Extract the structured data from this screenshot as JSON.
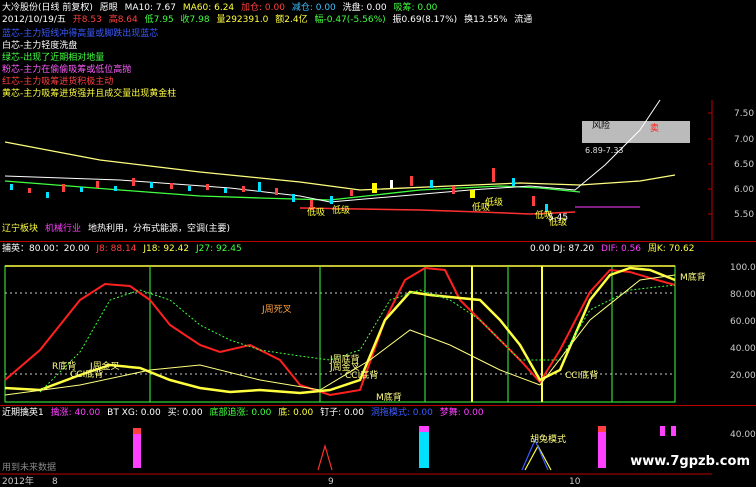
{
  "header": {
    "stock": "大冷股份(日线 前复权)",
    "indicator": "愿眼",
    "ma10": "MA10: 7.67",
    "ma60": "MA60: 6.24",
    "up": "加仓: 0.00",
    "down": "减仓: 0.00",
    "wash": "洗盘: 0.00",
    "absorb": "吸筹: 0.00",
    "date": "2012/10/19/五",
    "open": "开8.53",
    "high": "高8.64",
    "low": "低7.95",
    "close": "收7.98",
    "volume": "量292391.0",
    "amount": "额2.4亿",
    "change": "幅-0.47(-5.56%)",
    "amplitude": "振0.69(8.17%)",
    "turnover": "换13.55%",
    "circ": "流通"
  },
  "legend": [
    {
      "text": "蓝芯-主力短线冲得高量或脚跌出现蓝芯",
      "color": "#3b5bff"
    },
    {
      "text": "白芯-主力轻度洗盘",
      "color": "#ffffff"
    },
    {
      "text": "绿芯-出现了近期相对地量",
      "color": "#40ff40"
    },
    {
      "text": "粉芯-主力在偷偷吸筹或低位高抛",
      "color": "#ff60ff"
    },
    {
      "text": "红芯-主力吸筹进货积极主动",
      "color": "#ff4040"
    },
    {
      "text": "黄芯-主力吸筹进货强并且成交量出现黄金柱",
      "color": "#ffff40"
    }
  ],
  "main_chart": {
    "risk_label": "风险",
    "range_label": "6.89-7.33",
    "price_label": "5.45",
    "y_ticks": [
      "7.50",
      "7.00",
      "6.50",
      "6.00",
      "5.50"
    ],
    "markers": [
      "低吸",
      "低级",
      "低吸",
      "低级",
      "低吸",
      "低级"
    ],
    "sector": "辽宁板块",
    "industry": "机械行业",
    "notes": "地热利用，分布式能源，空调(主要)"
  },
  "indicator1": {
    "title": "捕英：80.00：20.00",
    "j8": "J8: 88.14",
    "j18": "J18: 92.42",
    "j27": "J27: 92.45",
    "dj": "0.00  DJ: 87.20",
    "dif": "DIF: 0.56",
    "zk": "周K: 70.62",
    "y_ticks": [
      "100.0",
      "80.00",
      "60.00",
      "40.00",
      "20.00"
    ],
    "annotations": [
      "J周死叉",
      "R底背",
      "J周金叉",
      "CCI底背",
      "J周底背",
      "J周金叉",
      "CCI底背",
      "M底背",
      "CCI底背",
      "M底背"
    ]
  },
  "indicator2": {
    "title": "近期擒英1",
    "t1": "擒涨: 40.00",
    "t2": "BT XG: 0.00",
    "t3": "买: 0.00",
    "t4": "底部追涨: 0.00",
    "t5": "底: 0.00",
    "t6": "钉子: 0.00",
    "t7": "洞拖模式: 0.00",
    "t8": "梦舞: 0.00",
    "pattern": "胡兔模式",
    "y_tick": "40.00",
    "source": "用到未来数据"
  },
  "xaxis": {
    "labels": [
      "2012年",
      "8",
      "9",
      "10"
    ]
  },
  "watermark": "www.7gpzb.com"
}
